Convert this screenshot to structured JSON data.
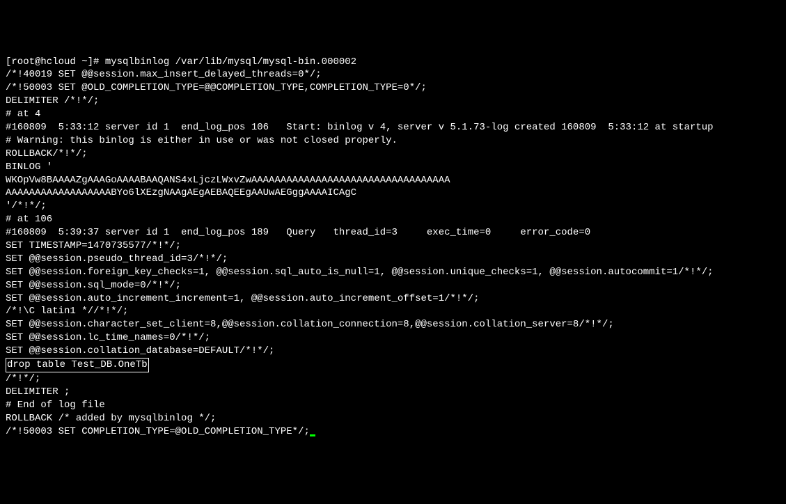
{
  "terminal": {
    "lines": [
      "[root@hcloud ~]# mysqlbinlog /var/lib/mysql/mysql-bin.000002",
      "/*!40019 SET @@session.max_insert_delayed_threads=0*/;",
      "/*!50003 SET @OLD_COMPLETION_TYPE=@@COMPLETION_TYPE,COMPLETION_TYPE=0*/;",
      "DELIMITER /*!*/;",
      "# at 4",
      "#160809  5:33:12 server id 1  end_log_pos 106   Start: binlog v 4, server v 5.1.73-log created 160809  5:33:12 at startup",
      "# Warning: this binlog is either in use or was not closed properly.",
      "ROLLBACK/*!*/;",
      "BINLOG '",
      "WKOpVw8BAAAAZgAAAGoAAAABAAQANS4xLjczLWxvZwAAAAAAAAAAAAAAAAAAAAAAAAAAAAAAAAAA",
      "AAAAAAAAAAAAAAAAAABYo6lXEzgNAAgAEgAEBAQEEgAAUwAEGggAAAAICAgC",
      "'/*!*/;",
      "# at 106",
      "#160809  5:39:37 server id 1  end_log_pos 189   Query   thread_id=3     exec_time=0     error_code=0",
      "SET TIMESTAMP=1470735577/*!*/;",
      "SET @@session.pseudo_thread_id=3/*!*/;",
      "SET @@session.foreign_key_checks=1, @@session.sql_auto_is_null=1, @@session.unique_checks=1, @@session.autocommit=1/*!*/;",
      "SET @@session.sql_mode=0/*!*/;",
      "SET @@session.auto_increment_increment=1, @@session.auto_increment_offset=1/*!*/;",
      "/*!\\C latin1 *//*!*/;",
      "SET @@session.character_set_client=8,@@session.collation_connection=8,@@session.collation_server=8/*!*/;",
      "SET @@session.lc_time_names=0/*!*/;",
      "SET @@session.collation_database=DEFAULT/*!*/;"
    ],
    "highlighted_line": "drop table Test_DB.OneTb",
    "lines_after": [
      "/*!*/;",
      "DELIMITER ;",
      "# End of log file",
      "ROLLBACK /* added by mysqlbinlog */;",
      "/*!50003 SET COMPLETION_TYPE=@OLD_COMPLETION_TYPE*/;"
    ]
  }
}
